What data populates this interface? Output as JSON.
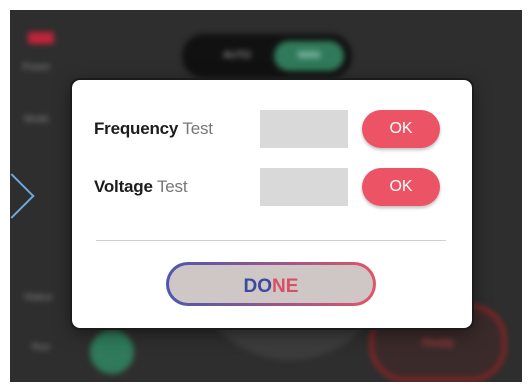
{
  "background": {
    "toggle_left": "AUTO",
    "toggle_right": "MAN",
    "side_labels": [
      "Power",
      "Mode",
      "Status",
      "Run"
    ],
    "ready_label": "Ready"
  },
  "dialog": {
    "rows": [
      {
        "label_strong": "Frequency",
        "label_light": "Test",
        "button": "OK"
      },
      {
        "label_strong": "Voltage",
        "label_light": "Test",
        "button": "OK"
      }
    ],
    "done_part1": "DO",
    "done_part2": "NE"
  },
  "colors": {
    "ok_button": "#ec5466",
    "done_gradient_start": "#4b57b0",
    "done_gradient_end": "#e0566a",
    "dialog_bg": "#ffffff",
    "app_bg": "#2e2e2e"
  }
}
